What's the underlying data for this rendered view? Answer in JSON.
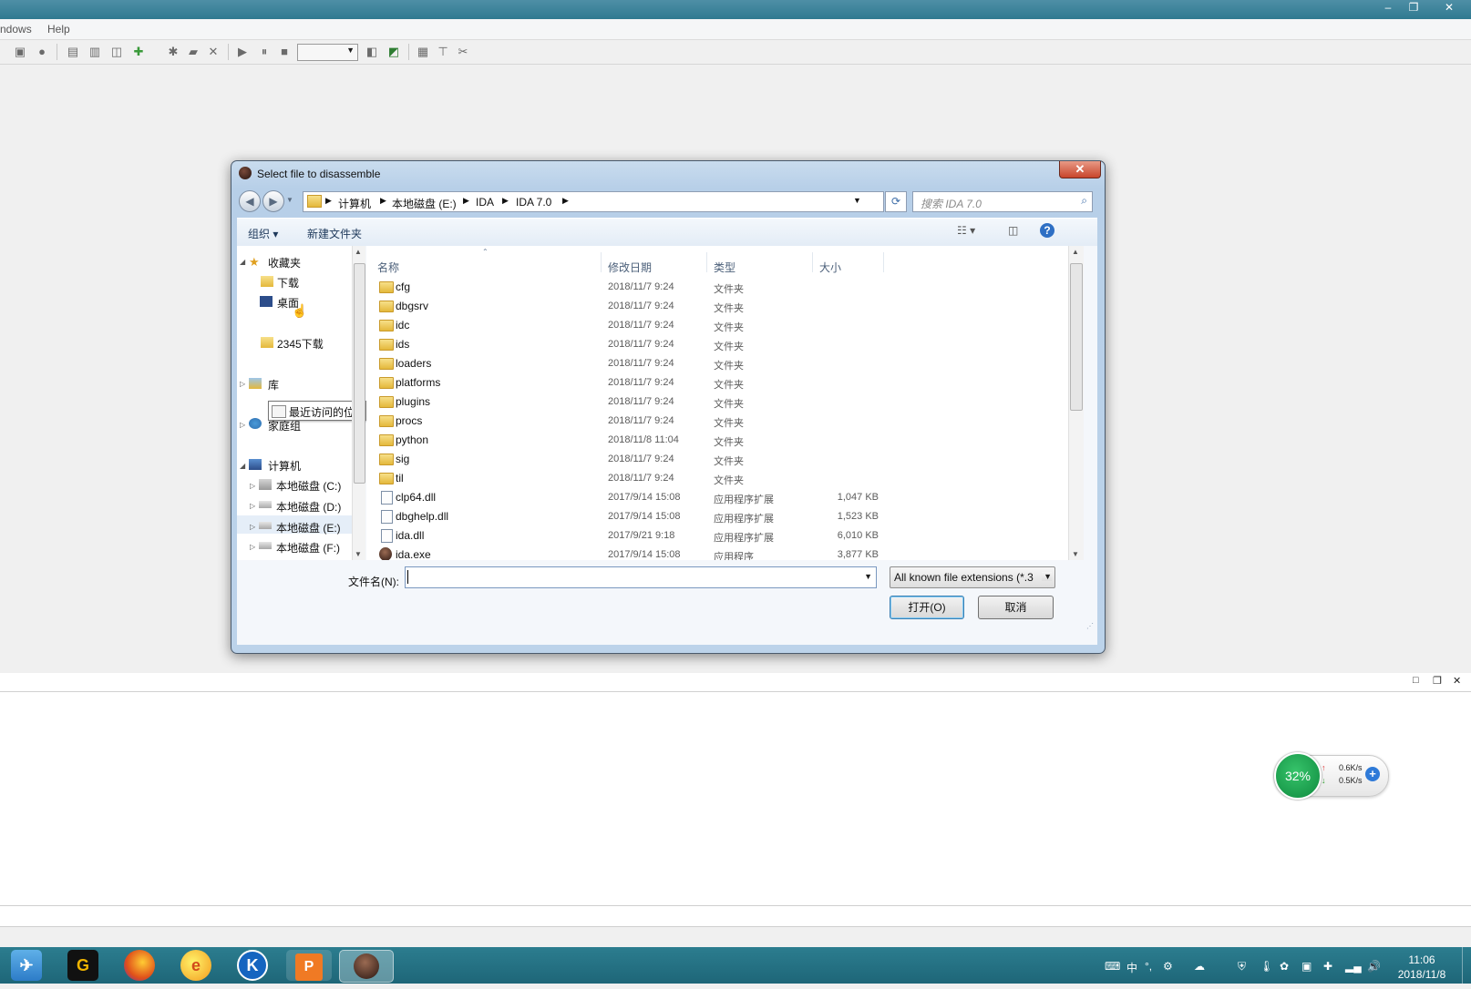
{
  "window": {
    "min": "–",
    "restore": "❐",
    "close": "✕"
  },
  "menu": {
    "windows": "ndows",
    "help": "Help"
  },
  "dialog": {
    "title": "Select file to disassemble",
    "close": "✕",
    "back": "◀",
    "forward": "▶",
    "breadcrumbs": [
      "计算机",
      "本地磁盘 (E:)",
      "IDA",
      "IDA 7.0"
    ],
    "search_placeholder": "搜索 IDA 7.0",
    "toolbar": {
      "organize": "组织 ▾",
      "new_folder": "新建文件夹"
    },
    "nav": {
      "favorites": "收藏夹",
      "downloads": "下载",
      "desktop": "桌面",
      "recent": "最近访问的位置",
      "dl2345": "2345下载",
      "libraries": "库",
      "homegroup": "家庭组",
      "computer": "计算机",
      "drive_c": "本地磁盘 (C:)",
      "drive_d": "本地磁盘 (D:)",
      "drive_e": "本地磁盘 (E:)",
      "drive_f": "本地磁盘 (F:)"
    },
    "columns": {
      "name": "名称",
      "date": "修改日期",
      "type": "类型",
      "size": "大小"
    },
    "files": [
      {
        "name": "cfg",
        "date": "2018/11/7 9:24",
        "type": "文件夹",
        "size": ""
      },
      {
        "name": "dbgsrv",
        "date": "2018/11/7 9:24",
        "type": "文件夹",
        "size": ""
      },
      {
        "name": "idc",
        "date": "2018/11/7 9:24",
        "type": "文件夹",
        "size": ""
      },
      {
        "name": "ids",
        "date": "2018/11/7 9:24",
        "type": "文件夹",
        "size": ""
      },
      {
        "name": "loaders",
        "date": "2018/11/7 9:24",
        "type": "文件夹",
        "size": ""
      },
      {
        "name": "platforms",
        "date": "2018/11/7 9:24",
        "type": "文件夹",
        "size": ""
      },
      {
        "name": "plugins",
        "date": "2018/11/7 9:24",
        "type": "文件夹",
        "size": ""
      },
      {
        "name": "procs",
        "date": "2018/11/7 9:24",
        "type": "文件夹",
        "size": ""
      },
      {
        "name": "python",
        "date": "2018/11/8 11:04",
        "type": "文件夹",
        "size": ""
      },
      {
        "name": "sig",
        "date": "2018/11/7 9:24",
        "type": "文件夹",
        "size": ""
      },
      {
        "name": "til",
        "date": "2018/11/7 9:24",
        "type": "文件夹",
        "size": ""
      },
      {
        "name": "clp64.dll",
        "date": "2017/9/14 15:08",
        "type": "应用程序扩展",
        "size": "1,047 KB"
      },
      {
        "name": "dbghelp.dll",
        "date": "2017/9/14 15:08",
        "type": "应用程序扩展",
        "size": "1,523 KB"
      },
      {
        "name": "ida.dll",
        "date": "2017/9/21 9:18",
        "type": "应用程序扩展",
        "size": "6,010 KB"
      },
      {
        "name": "ida.exe",
        "date": "2017/9/14 15:08",
        "type": "应用程序",
        "size": "3,877 KB"
      }
    ],
    "filename_label": "文件名(N):",
    "filename_value": "",
    "filter": "All known file extensions (*.3",
    "open_button": "打开(O)",
    "cancel_button": "取消"
  },
  "taskbar": {
    "clock_time": "11:06",
    "clock_date": "2018/11/8",
    "ime": "中"
  },
  "netwidget": {
    "cpu": "32%",
    "up": "0.6K/s",
    "down": "0.5K/s"
  }
}
